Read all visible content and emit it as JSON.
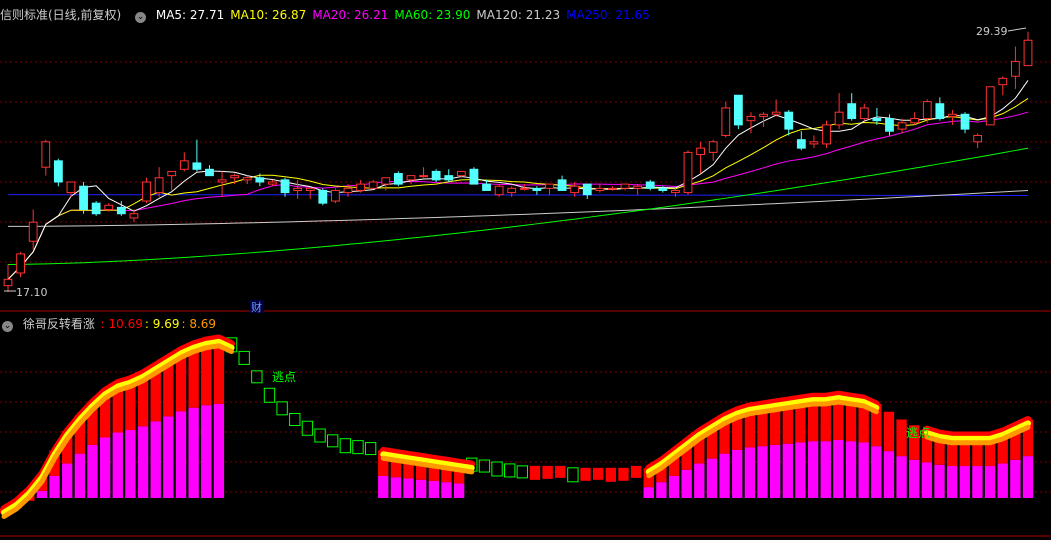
{
  "main_header": {
    "title": "信则标准(日线,前复权)",
    "gear_icon": "circle-chevron-icon",
    "ma": [
      {
        "label": "MA5: 27.71",
        "color": "#ffffff"
      },
      {
        "label": "MA10: 26.87",
        "color": "#ffff00"
      },
      {
        "label": "MA20: 26.21",
        "color": "#ff00ff"
      },
      {
        "label": "MA60: 23.90",
        "color": "#00ff00"
      },
      {
        "label": "MA120: 21.23",
        "color": "#cccccc"
      },
      {
        "label": "MA250: 21.65",
        "color": "#0000ff"
      }
    ]
  },
  "sub_header": {
    "title": "徐哥反转看涨",
    "values": [
      {
        "label": ": 10.69",
        "color": "#ff0000"
      },
      {
        "label": ": 9.69",
        "color": "#ffff00"
      },
      {
        "label": ": 8.69",
        "color": "#ff9900"
      }
    ]
  },
  "annotations": {
    "high_label": "29.39",
    "low_label": "17.10",
    "finance_marker": "财",
    "escape_label_1": "逃点",
    "escape_label_2": "逃点"
  },
  "colors": {
    "up": "#ff3232",
    "down": "#54ffff",
    "grid": "#800000",
    "ma5": "#ffffff",
    "ma10": "#ffff00",
    "ma20": "#ff00ff",
    "ma60": "#00ff00",
    "ma120": "#cccccc",
    "ma250": "#2020ff",
    "bar_magenta": "#ff00ff",
    "bar_red": "#ff0000",
    "bar_green": "#00ff00",
    "line_red": "#ff0000",
    "line_yellow": "#ffff00",
    "line_orange": "#ff9900"
  },
  "chart_data": [
    {
      "type": "candlestick",
      "ylim": [
        17.1,
        29.39
      ],
      "candles": [
        [
          17.4,
          18.4,
          17.1,
          17.7
        ],
        [
          18.0,
          19.0,
          17.8,
          18.9
        ],
        [
          19.5,
          21.0,
          19.1,
          20.4
        ],
        [
          23.0,
          24.3,
          22.6,
          24.2
        ],
        [
          23.3,
          23.4,
          22.1,
          22.3
        ],
        [
          21.8,
          22.3,
          21.6,
          22.3
        ],
        [
          22.1,
          22.3,
          20.8,
          21.0
        ],
        [
          21.3,
          21.4,
          20.7,
          20.8
        ],
        [
          21.0,
          21.3,
          20.9,
          21.2
        ],
        [
          21.1,
          21.4,
          20.7,
          20.8
        ],
        [
          20.6,
          21.0,
          20.4,
          20.8
        ],
        [
          21.4,
          22.5,
          21.3,
          22.3
        ],
        [
          21.8,
          23.0,
          21.6,
          22.5
        ],
        [
          22.6,
          22.8,
          21.9,
          22.8
        ],
        [
          22.9,
          23.7,
          22.8,
          23.3
        ],
        [
          23.2,
          24.3,
          22.8,
          22.9
        ],
        [
          22.9,
          23.1,
          22.6,
          22.6
        ],
        [
          22.3,
          22.8,
          21.6,
          22.4
        ],
        [
          22.5,
          22.7,
          22.2,
          22.6
        ],
        [
          22.4,
          22.6,
          22.2,
          22.5
        ],
        [
          22.5,
          22.7,
          22.1,
          22.3
        ],
        [
          22.2,
          22.4,
          22.1,
          22.3
        ],
        [
          22.4,
          22.5,
          21.6,
          21.8
        ],
        [
          21.9,
          22.4,
          21.5,
          22.0
        ],
        [
          21.9,
          22.0,
          21.5,
          22.0
        ],
        [
          21.9,
          22.0,
          21.2,
          21.3
        ],
        [
          21.4,
          22.0,
          21.3,
          21.9
        ],
        [
          21.8,
          22.2,
          21.6,
          22.0
        ],
        [
          21.9,
          22.4,
          21.8,
          22.2
        ],
        [
          22.0,
          22.4,
          22.0,
          22.3
        ],
        [
          22.2,
          22.5,
          21.9,
          22.5
        ],
        [
          22.7,
          22.8,
          22.1,
          22.2
        ],
        [
          22.4,
          22.6,
          22.2,
          22.6
        ],
        [
          22.6,
          23.0,
          22.5,
          22.6
        ],
        [
          22.8,
          22.9,
          22.3,
          22.4
        ],
        [
          22.6,
          22.9,
          22.3,
          22.4
        ],
        [
          22.6,
          22.8,
          22.5,
          22.8
        ],
        [
          22.9,
          23.0,
          22.2,
          22.2
        ],
        [
          22.2,
          22.4,
          21.9,
          21.9
        ],
        [
          21.7,
          22.2,
          21.6,
          22.1
        ],
        [
          21.8,
          22.1,
          21.6,
          22.0
        ],
        [
          22.0,
          22.2,
          21.9,
          22.0
        ],
        [
          22.0,
          22.1,
          21.7,
          21.9
        ],
        [
          22.0,
          22.2,
          21.7,
          22.2
        ],
        [
          22.4,
          22.6,
          21.9,
          21.9
        ],
        [
          21.8,
          22.3,
          21.6,
          22.1
        ],
        [
          22.2,
          22.2,
          21.5,
          21.7
        ],
        [
          21.9,
          22.2,
          21.8,
          22.0
        ],
        [
          22.0,
          22.1,
          21.9,
          22.0
        ],
        [
          22.0,
          22.2,
          21.9,
          22.2
        ],
        [
          22.0,
          22.2,
          21.7,
          22.1
        ],
        [
          22.3,
          22.4,
          21.9,
          22.0
        ],
        [
          22.0,
          22.1,
          21.8,
          21.9
        ],
        [
          21.8,
          22.0,
          21.6,
          21.9
        ],
        [
          21.8,
          23.8,
          21.7,
          23.7
        ],
        [
          23.6,
          24.2,
          22.7,
          23.9
        ],
        [
          23.7,
          24.3,
          23.3,
          24.2
        ],
        [
          24.5,
          26.1,
          24.4,
          25.8
        ],
        [
          26.4,
          26.4,
          24.8,
          25.0
        ],
        [
          25.2,
          25.6,
          24.6,
          25.4
        ],
        [
          25.4,
          25.6,
          24.9,
          25.5
        ],
        [
          25.5,
          26.2,
          25.4,
          25.6
        ],
        [
          25.6,
          25.7,
          24.5,
          24.8
        ],
        [
          24.3,
          24.7,
          23.8,
          23.9
        ],
        [
          24.1,
          24.5,
          23.9,
          24.2
        ],
        [
          24.1,
          25.2,
          23.9,
          25.0
        ],
        [
          25.0,
          26.5,
          24.8,
          25.6
        ],
        [
          26.0,
          26.5,
          25.2,
          25.3
        ],
        [
          25.3,
          26.0,
          25.2,
          25.8
        ],
        [
          25.3,
          25.8,
          25.0,
          25.2
        ],
        [
          25.3,
          25.5,
          24.5,
          24.7
        ],
        [
          24.8,
          25.3,
          24.6,
          25.1
        ],
        [
          25.1,
          25.6,
          25.0,
          25.3
        ],
        [
          25.3,
          26.2,
          25.1,
          26.1
        ],
        [
          26.0,
          26.3,
          25.2,
          25.3
        ],
        [
          25.4,
          25.7,
          25.0,
          25.5
        ],
        [
          25.5,
          25.6,
          24.6,
          24.8
        ],
        [
          24.2,
          24.6,
          23.9,
          24.5
        ],
        [
          25.0,
          26.8,
          25.0,
          26.8
        ],
        [
          26.9,
          27.3,
          26.4,
          27.2
        ],
        [
          27.3,
          28.7,
          26.7,
          28.0
        ],
        [
          27.8,
          29.4,
          27.8,
          29.0
        ]
      ]
    },
    {
      "type": "indicator",
      "title": "徐哥反转看涨",
      "series": [
        {
          "name": "10.69",
          "values": [
            0.12,
            0.16,
            0.22,
            0.3,
            0.42,
            0.52,
            0.6,
            0.67,
            0.73,
            0.77,
            0.79,
            0.82,
            0.86,
            0.9,
            0.94,
            0.97,
            0.99,
            1.0,
            0.97,
            0.9,
            0.8,
            0.71,
            0.64,
            0.58,
            0.54,
            0.5,
            0.47,
            0.45,
            0.44,
            0.43,
            0.42,
            0.41,
            0.4,
            0.39,
            0.38,
            0.37,
            0.36,
            0.35,
            0.34,
            0.33,
            0.32,
            0.31,
            0.31,
            0.31,
            0.31,
            0.3,
            0.3,
            0.3,
            0.3,
            0.3,
            0.31,
            0.33,
            0.37,
            0.42,
            0.47,
            0.52,
            0.56,
            0.6,
            0.63,
            0.65,
            0.66,
            0.67,
            0.68,
            0.69,
            0.7,
            0.7,
            0.71,
            0.7,
            0.69,
            0.66,
            0.62,
            0.58,
            0.55,
            0.53,
            0.51,
            0.5,
            0.5,
            0.5,
            0.5,
            0.52,
            0.55,
            0.58
          ]
        },
        {
          "name": "9.69",
          "values": [
            0.1,
            0.14,
            0.2,
            0.28,
            0.4,
            0.5,
            0.58,
            0.65,
            0.71,
            0.75,
            0.77,
            0.8,
            0.84,
            0.88,
            0.92,
            0.95,
            0.97,
            0.98,
            0.95,
            0.88,
            0.78,
            0.69,
            0.62,
            0.56,
            0.52,
            0.48,
            0.45,
            0.43,
            0.42,
            0.41,
            0.4,
            0.39,
            0.38,
            0.37,
            0.36,
            0.35,
            0.34,
            0.33,
            0.32,
            0.31,
            0.3,
            0.29,
            0.29,
            0.29,
            0.29,
            0.28,
            0.28,
            0.28,
            0.28,
            0.28,
            0.29,
            0.31,
            0.35,
            0.4,
            0.45,
            0.5,
            0.54,
            0.58,
            0.61,
            0.63,
            0.64,
            0.65,
            0.66,
            0.67,
            0.68,
            0.68,
            0.69,
            0.68,
            0.67,
            0.64,
            0.6,
            0.56,
            0.53,
            0.51,
            0.49,
            0.48,
            0.48,
            0.48,
            0.48,
            0.5,
            0.53,
            0.56
          ]
        },
        {
          "name": "8.69",
          "values": [
            0.08,
            0.12,
            0.18,
            0.26,
            0.38,
            0.48,
            0.56,
            0.63,
            0.69,
            0.73,
            0.75,
            0.78,
            0.82,
            0.86,
            0.9,
            0.93,
            0.95,
            0.96,
            0.93,
            0.86,
            0.76,
            0.67,
            0.6,
            0.54,
            0.5,
            0.46,
            0.43,
            0.41,
            0.4,
            0.39,
            0.38,
            0.37,
            0.36,
            0.35,
            0.34,
            0.33,
            0.32,
            0.31,
            0.3,
            0.29,
            0.28,
            0.27,
            0.27,
            0.27,
            0.27,
            0.26,
            0.26,
            0.26,
            0.26,
            0.26,
            0.27,
            0.29,
            0.33,
            0.38,
            0.43,
            0.48,
            0.52,
            0.56,
            0.59,
            0.61,
            0.62,
            0.63,
            0.64,
            0.65,
            0.66,
            0.66,
            0.67,
            0.66,
            0.65,
            0.62,
            0.58,
            0.54,
            0.51,
            0.49,
            0.47,
            0.46,
            0.46,
            0.46,
            0.46,
            0.48,
            0.51,
            0.54
          ]
        }
      ]
    }
  ]
}
